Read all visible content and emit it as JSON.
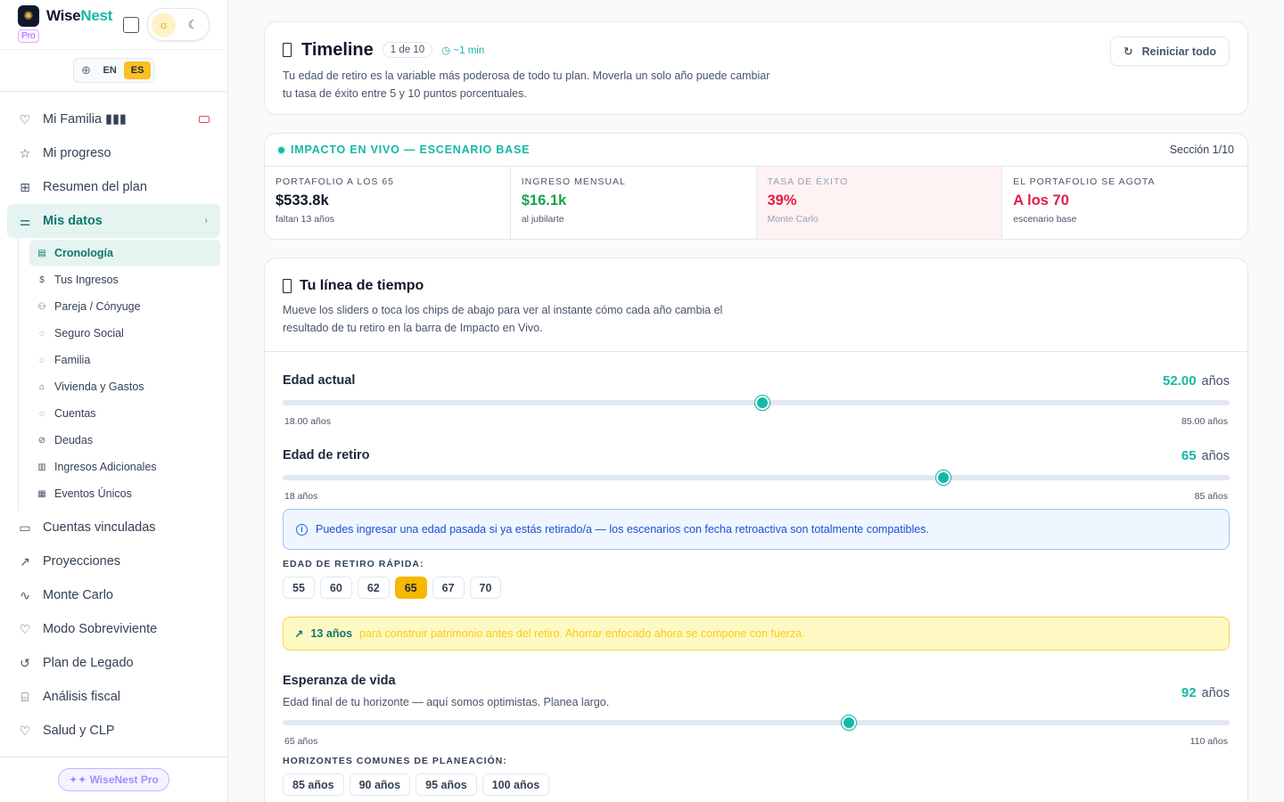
{
  "brand": {
    "name_a": "Wise",
    "name_b": "Nest",
    "tier": "Pro"
  },
  "lang": {
    "en": "EN",
    "es": "ES"
  },
  "nav": [
    {
      "label": "Mi Familia ▮▮▮",
      "icon": "heart-icon"
    },
    {
      "label": "Mi progreso",
      "icon": "star-icon"
    },
    {
      "label": "Resumen del plan",
      "icon": "grid-icon"
    },
    {
      "label": "Mis datos",
      "icon": "sliders-icon"
    }
  ],
  "subnav": [
    {
      "label": "Cronología",
      "icon": "calendar-icon"
    },
    {
      "label": "Tus Ingresos",
      "icon": "dollar-icon"
    },
    {
      "label": "Pareja / Cónyuge",
      "icon": "users-icon"
    },
    {
      "label": "Seguro Social",
      "icon": "shield-icon"
    },
    {
      "label": "Familia",
      "icon": "family-icon"
    },
    {
      "label": "Vivienda y Gastos",
      "icon": "home-icon"
    },
    {
      "label": "Cuentas",
      "icon": "piggy-bank-icon"
    },
    {
      "label": "Deudas",
      "icon": "debt-icon"
    },
    {
      "label": "Ingresos Adicionales",
      "icon": "briefcase-icon"
    },
    {
      "label": "Eventos Únicos",
      "icon": "gift-icon"
    }
  ],
  "nav2": [
    {
      "label": "Cuentas vinculadas",
      "icon": "wallet-icon"
    },
    {
      "label": "Proyecciones",
      "icon": "trending-up-icon"
    },
    {
      "label": "Monte Carlo",
      "icon": "activity-icon"
    },
    {
      "label": "Modo Sobreviviente",
      "icon": "heart-icon"
    },
    {
      "label": "Plan de Legado",
      "icon": "legacy-icon"
    },
    {
      "label": "Análisis fiscal",
      "icon": "bank-icon"
    },
    {
      "label": "Salud y CLP",
      "icon": "health-icon"
    }
  ],
  "pro_button": "✦✦ WiseNest Pro",
  "header": {
    "title": "Timeline",
    "step": "1 de 10",
    "time": "~1 min",
    "desc": "Tu edad de retiro es la variable más poderosa de todo tu plan. Moverla un solo año puede cambiar tu tasa de éxito entre 5 y 10 puntos porcentuales.",
    "reset": "Reiniciar todo"
  },
  "impact": {
    "title": "IMPACTO EN VIVO — ESCENARIO BASE",
    "section": "Sección 1/10",
    "kpis": [
      {
        "label": "PORTAFOLIO A LOS 65",
        "value": "$533.8k",
        "sub": "faltan 13 años",
        "color": "#0f172a"
      },
      {
        "label": "INGRESO MENSUAL",
        "value": "$16.1k",
        "sub": "al jubilarte",
        "color": "#16a34a"
      },
      {
        "label": "TASA DE ÉXITO",
        "value": "39%",
        "sub": "Monte Carlo",
        "color": "#e11d48"
      },
      {
        "label": "EL PORTAFOLIO SE AGOTA",
        "value": "A los 70",
        "sub": "escenario base",
        "color": "#e11d48"
      }
    ]
  },
  "timeline": {
    "title": "Tu línea de tiempo",
    "desc": "Mueve los sliders o toca los chips de abajo para ver al instante cómo cada año cambia el resultado de tu retiro en la barra de Impacto en Vivo.",
    "current_age": {
      "label": "Edad actual",
      "value": "52.00",
      "unit": "años",
      "min": "18.00 años",
      "max": "85.00 años",
      "fraction": 0.507
    },
    "retire_age": {
      "label": "Edad de retiro",
      "value": "65",
      "unit": "años",
      "min": "18 años",
      "max": "85 años",
      "fraction": 0.698
    },
    "info": "Puedes ingresar una edad pasada si ya estás retirado/a — los escenarios con fecha retroactiva son totalmente compatibles.",
    "quick_label": "EDAD DE RETIRO RÁPIDA:",
    "quick_chips": [
      "55",
      "60",
      "62",
      "65",
      "67",
      "70"
    ],
    "warn_em": "13 años",
    "warn_rest": "para construir patrimonio antes del retiro. Ahorrar enfocado ahora se compone con fuerza.",
    "life": {
      "label": "Esperanza de vida",
      "sub": "Edad final de tu horizonte — aquí somos optimistas. Planea largo.",
      "value": "92",
      "unit": "años",
      "min": "65 años",
      "max": "110 años",
      "fraction": 0.598
    },
    "horizons_label": "HORIZONTES COMUNES DE PLANEACIÓN:",
    "horizons": [
      "85 años",
      "90 años",
      "95 años",
      "100 años"
    ]
  }
}
